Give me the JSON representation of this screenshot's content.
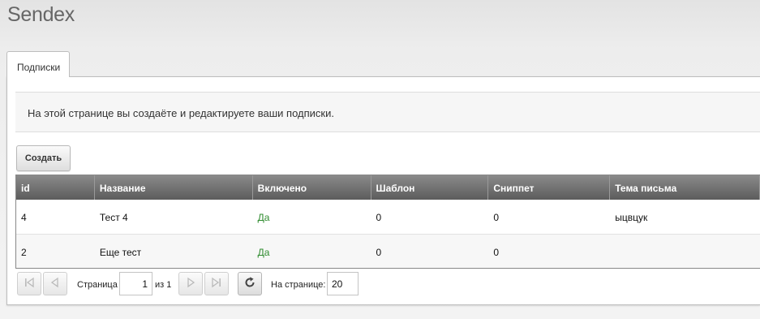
{
  "app": {
    "title": "Sendex"
  },
  "tabs": [
    {
      "label": "Подписки"
    }
  ],
  "info": {
    "text": "На этой странице вы создаёте и редактируете ваши подписки."
  },
  "toolbar": {
    "create_label": "Создать"
  },
  "grid": {
    "columns": [
      "id",
      "Название",
      "Включено",
      "Шаблон",
      "Сниппет",
      "Тема письма"
    ],
    "rows": [
      {
        "id": "4",
        "name": "Тест 4",
        "enabled": "Да",
        "template": "0",
        "snippet": "0",
        "subject": "ыцвцук"
      },
      {
        "id": "2",
        "name": "Еще тест",
        "enabled": "Да",
        "template": "0",
        "snippet": "0",
        "subject": ""
      }
    ]
  },
  "pager": {
    "page_label": "Страница",
    "page_value": "1",
    "of_label": "из 1",
    "per_page_label": "На странице:",
    "per_page_value": "20"
  },
  "colors": {
    "enabled_yes": "#2e8b2e",
    "header_bg": "#6e6e6e"
  },
  "icons": [
    "first-page-icon",
    "prev-page-icon",
    "next-page-icon",
    "last-page-icon",
    "refresh-icon"
  ]
}
